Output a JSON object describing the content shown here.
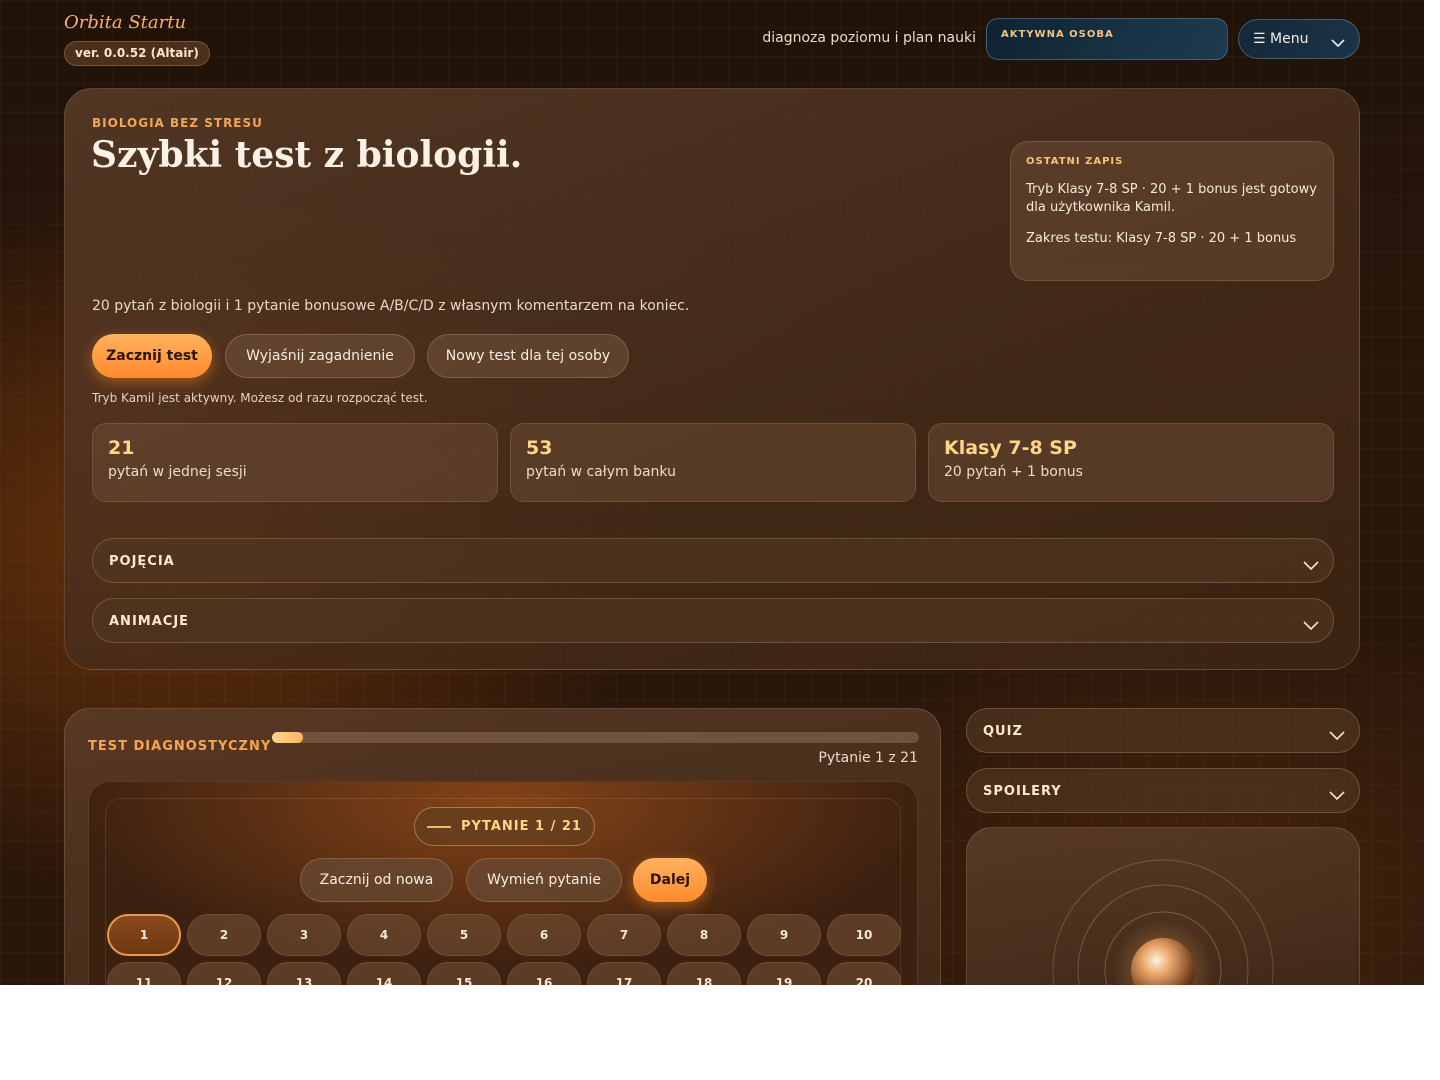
{
  "header": {
    "brand": "Orbita Startu",
    "version": "ver. 0.0.52 (Altair)",
    "tagline": "diagnoza poziomu i plan nauki",
    "active_person_label": "AKTYWNA OSOBA",
    "menu_label": "☰ Menu"
  },
  "hero": {
    "eyebrow": "BIOLOGIA BEZ STRESU",
    "title": "Szybki test z biologii.",
    "last_save": {
      "title": "OSTATNI ZAPIS",
      "line1": "Tryb Klasy 7-8 SP · 20 + 1 bonus jest gotowy dla użytkownika Kamil.",
      "line2": "Zakres testu: Klasy 7-8 SP · 20 + 1 bonus"
    },
    "description": "20 pytań z biologii i 1 pytanie bonusowe A/B/C/D z własnym komentarzem na koniec.",
    "buttons": {
      "start": "Zacznij test",
      "explain": "Wyjaśnij zagadnienie",
      "new_test": "Nowy test dla tej osoby"
    },
    "status": "Tryb Kamil jest aktywny. Możesz od razu rozpocząć test.",
    "stats": [
      {
        "value": "21",
        "label": "pytań w jednej sesji"
      },
      {
        "value": "53",
        "label": "pytań w całym banku"
      },
      {
        "value": "Klasy 7-8 SP",
        "label": "20 pytań + 1 bonus"
      }
    ],
    "accordions": [
      "POJĘCIA",
      "ANIMACJE"
    ]
  },
  "test": {
    "title": "TEST DIAGNOSTYCZNY",
    "progress_fraction": 0.048,
    "question_count": "Pytanie 1 z 21",
    "question_pill": "PYTANIE 1 / 21",
    "buttons": {
      "restart": "Zacznij od nowa",
      "swap": "Wymień pytanie",
      "next": "Dalej"
    },
    "questions": [
      "1",
      "2",
      "3",
      "4",
      "5",
      "6",
      "7",
      "8",
      "9",
      "10",
      "11",
      "12",
      "13",
      "14",
      "15",
      "16",
      "17",
      "18",
      "19",
      "20"
    ],
    "current": 1
  },
  "side": {
    "accordions": [
      "QUIZ",
      "SPOILERY"
    ]
  },
  "colors": {
    "accent": "#ff9b3d",
    "accent_light": "#ffd58a",
    "panel": "#4a2f1c",
    "background": "#24140a"
  }
}
